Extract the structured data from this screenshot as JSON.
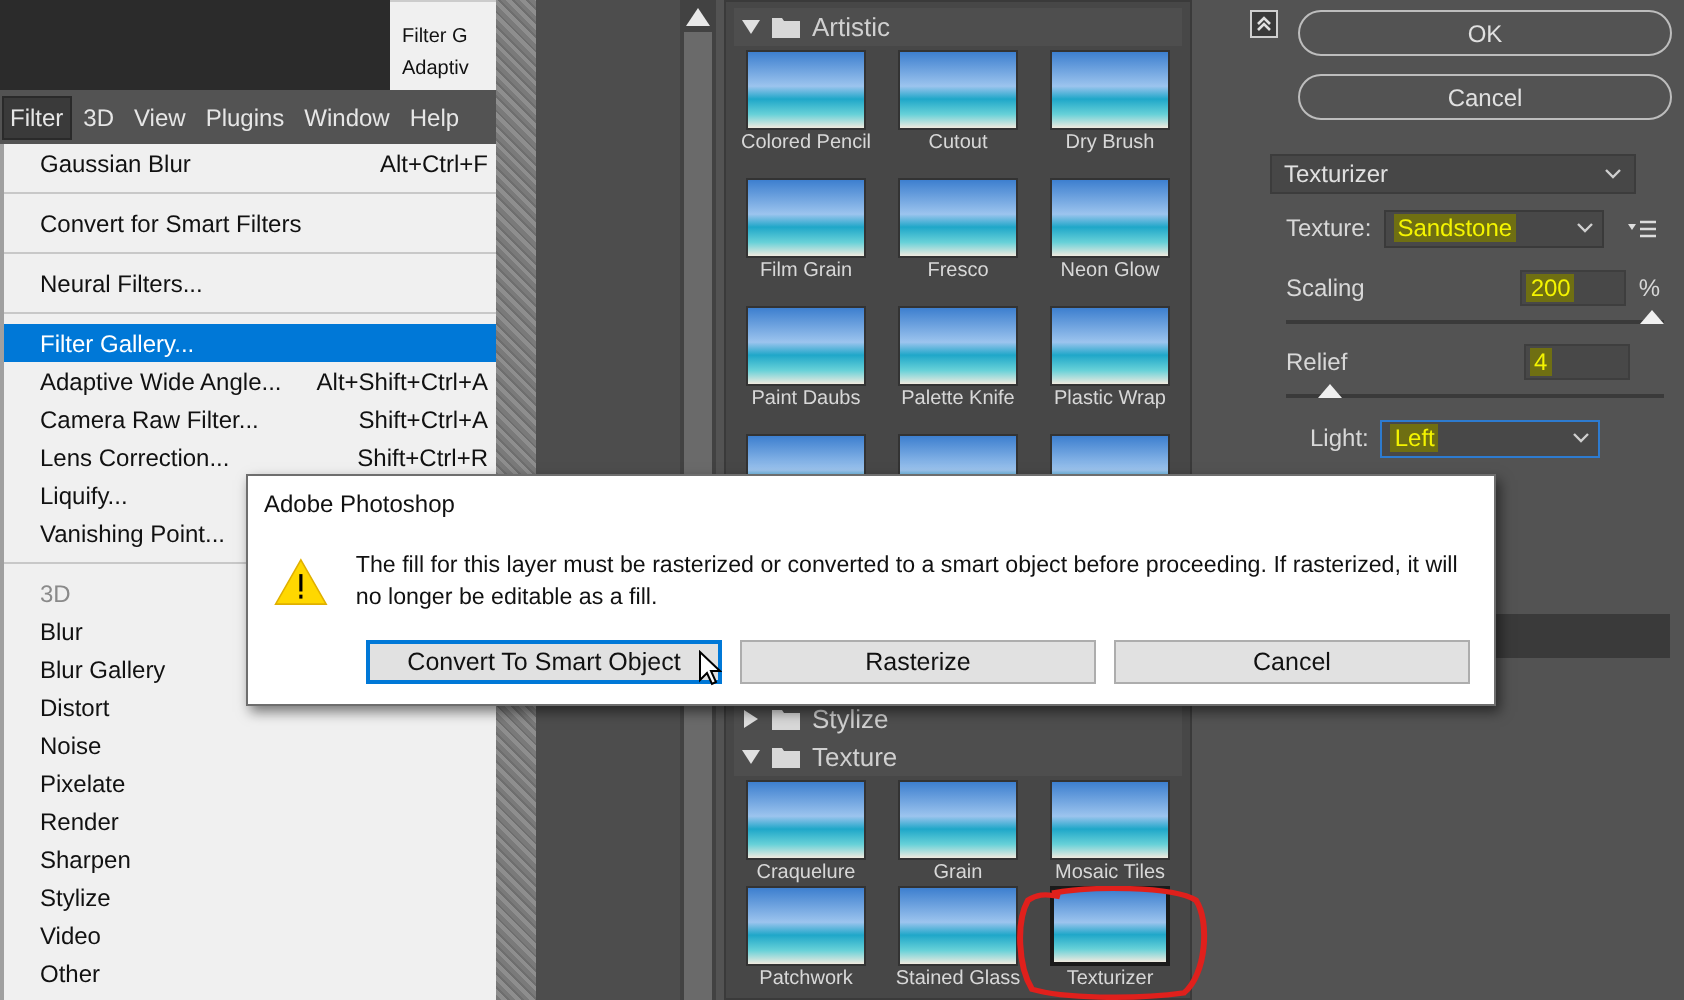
{
  "background_menu": {
    "items": [
      "Filter G",
      "Adaptiv"
    ]
  },
  "menubar": [
    {
      "label": "Filter",
      "selected": true
    },
    {
      "label": "3D",
      "selected": false
    },
    {
      "label": "View",
      "selected": false
    },
    {
      "label": "Plugins",
      "selected": false
    },
    {
      "label": "Window",
      "selected": false
    },
    {
      "label": "Help",
      "selected": false
    }
  ],
  "filter_menu": {
    "items": [
      {
        "kind": "item",
        "label": "Gaussian Blur",
        "shortcut": "Alt+Ctrl+F",
        "selected": false,
        "disabled": false
      },
      {
        "kind": "separator"
      },
      {
        "kind": "item",
        "label": "Convert for Smart Filters",
        "selected": false,
        "disabled": false
      },
      {
        "kind": "separator"
      },
      {
        "kind": "item",
        "label": "Neural Filters...",
        "selected": false,
        "disabled": false
      },
      {
        "kind": "separator"
      },
      {
        "kind": "item",
        "label": "Filter Gallery...",
        "selected": true,
        "disabled": false
      },
      {
        "kind": "item",
        "label": "Adaptive Wide Angle...",
        "shortcut": "Alt+Shift+Ctrl+A",
        "selected": false,
        "disabled": false
      },
      {
        "kind": "item",
        "label": "Camera Raw Filter...",
        "shortcut": "Shift+Ctrl+A",
        "selected": false,
        "disabled": false
      },
      {
        "kind": "item",
        "label": "Lens Correction...",
        "shortcut": "Shift+Ctrl+R",
        "selected": false,
        "disabled": false
      },
      {
        "kind": "item",
        "label": "Liquify...",
        "selected": false,
        "disabled": false
      },
      {
        "kind": "item",
        "label": "Vanishing Point...",
        "selected": false,
        "disabled": false
      },
      {
        "kind": "separator"
      },
      {
        "kind": "item",
        "label": "3D",
        "selected": false,
        "disabled": true
      },
      {
        "kind": "item",
        "label": "Blur",
        "selected": false,
        "disabled": false
      },
      {
        "kind": "item",
        "label": "Blur Gallery",
        "selected": false,
        "disabled": false
      },
      {
        "kind": "item",
        "label": "Distort",
        "selected": false,
        "disabled": false
      },
      {
        "kind": "item",
        "label": "Noise",
        "selected": false,
        "disabled": false
      },
      {
        "kind": "item",
        "label": "Pixelate",
        "selected": false,
        "disabled": false
      },
      {
        "kind": "item",
        "label": "Render",
        "selected": false,
        "disabled": false
      },
      {
        "kind": "item",
        "label": "Sharpen",
        "selected": false,
        "disabled": false
      },
      {
        "kind": "item",
        "label": "Stylize",
        "selected": false,
        "disabled": false
      },
      {
        "kind": "item",
        "label": "Video",
        "selected": false,
        "disabled": false
      },
      {
        "kind": "item",
        "label": "Other",
        "selected": false,
        "disabled": false
      }
    ]
  },
  "gallery": {
    "categories": [
      {
        "name": "Artistic",
        "expanded": true,
        "filters": [
          {
            "label": "Colored Pencil",
            "selected": false
          },
          {
            "label": "Cutout",
            "selected": false
          },
          {
            "label": "Dry Brush",
            "selected": false
          },
          {
            "label": "Film Grain",
            "selected": false
          },
          {
            "label": "Fresco",
            "selected": false
          },
          {
            "label": "Neon Glow",
            "selected": false
          },
          {
            "label": "Paint Daubs",
            "selected": false
          },
          {
            "label": "Palette Knife",
            "selected": false
          },
          {
            "label": "Plastic Wrap",
            "selected": false
          },
          {
            "selected": false
          },
          {
            "selected": false
          },
          {
            "selected": false
          }
        ]
      },
      {
        "name": "Stylize",
        "expanded": false
      },
      {
        "name": "Texture",
        "expanded": true,
        "filters": [
          {
            "label": "Craquelure",
            "selected": false
          },
          {
            "label": "Grain",
            "selected": false
          },
          {
            "label": "Mosaic Tiles",
            "selected": false
          },
          {
            "label": "Patchwork",
            "selected": false
          },
          {
            "label": "Stained Glass",
            "selected": false
          },
          {
            "label": "Texturizer",
            "selected": true
          }
        ]
      }
    ]
  },
  "settings": {
    "buttons": [
      "OK",
      "Cancel"
    ],
    "filter": "Texturizer",
    "texture": {
      "label": "Texture:",
      "value": "Sandstone",
      "highlighted": true
    },
    "scaling": {
      "label": "Scaling",
      "value": "200",
      "unit": "%",
      "level": 1.0,
      "highlighted": true
    },
    "relief": {
      "label": "Relief",
      "value": "4",
      "level": 0.09,
      "highlighted": true
    },
    "light": {
      "label": "Light:",
      "value": "Left",
      "highlighted": true,
      "focused": true
    }
  },
  "dialog": {
    "title": "Adobe Photoshop",
    "message": "The fill for this layer must be rasterized or converted to a smart object before proceeding. If rasterized, it will no longer be editable as a fill.",
    "buttons": [
      {
        "label": "Convert To Smart Object",
        "focused": true
      },
      {
        "label": "Rasterize",
        "focused": false
      },
      {
        "label": "Cancel",
        "focused": false
      }
    ]
  }
}
